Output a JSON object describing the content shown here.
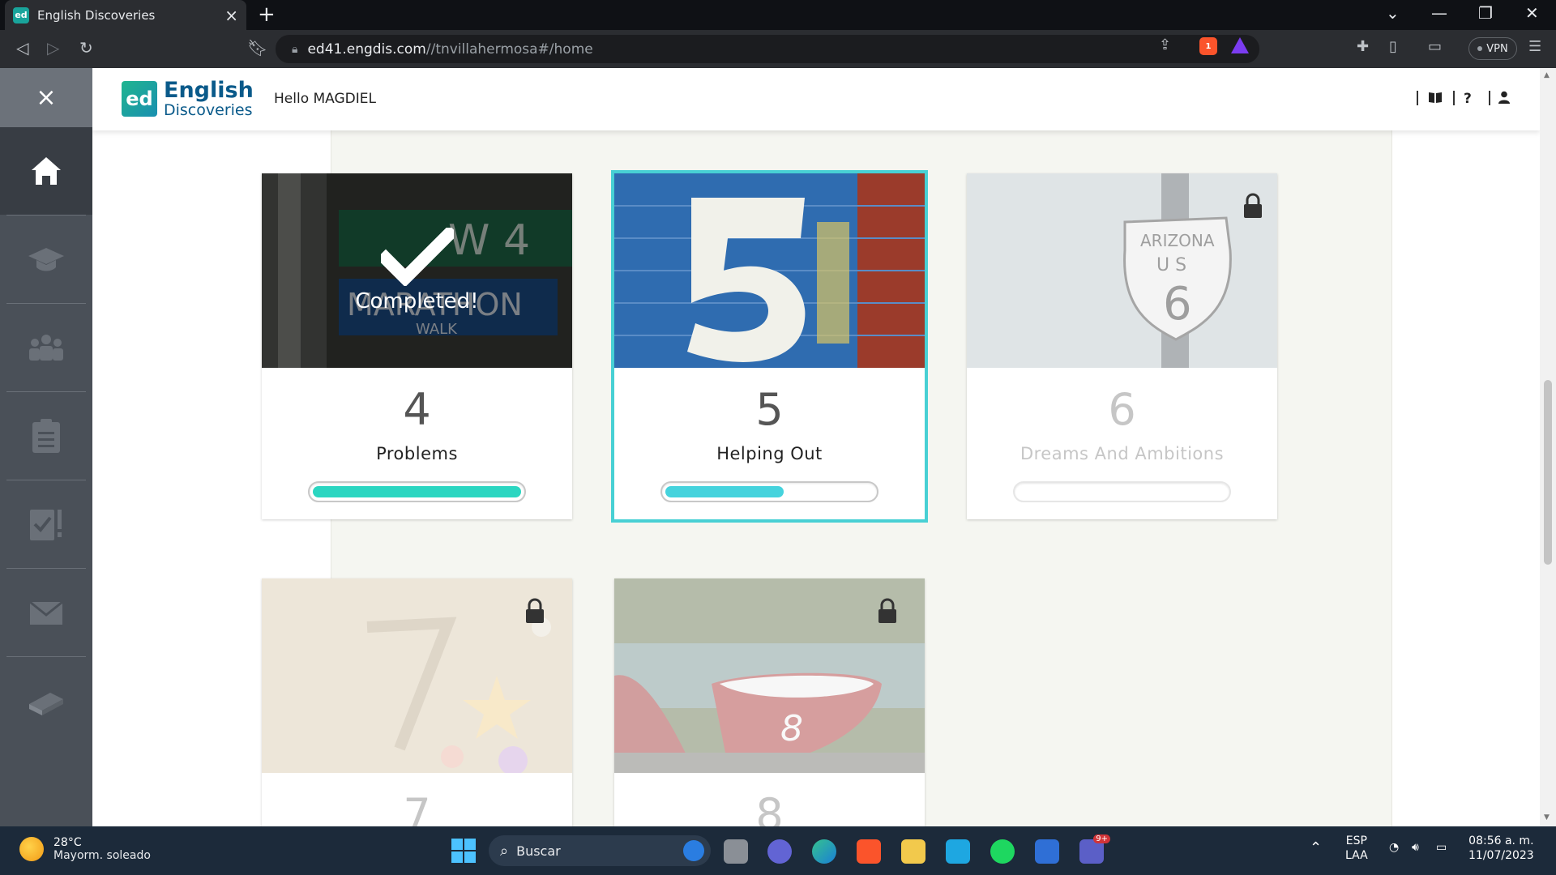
{
  "browser": {
    "tab_title": "English Discoveries",
    "tab_favicon": "ed",
    "url_host": "ed41.engdis.com",
    "url_path": "//tnvillahermosa#/home",
    "vpn_label": "VPN",
    "brave_count": "1"
  },
  "app": {
    "logo_badge": "ed",
    "logo_line1": "English",
    "logo_line2": "Discoveries",
    "greeting": "Hello MAGDIEL",
    "header_icons": [
      "book-icon",
      "help-icon",
      "user-icon"
    ],
    "help_label": "?"
  },
  "sidebar": {
    "close_label": "×",
    "items": [
      {
        "name": "home",
        "icon": "home-icon",
        "active": true
      },
      {
        "name": "courses",
        "icon": "graduation-cap-icon",
        "active": false
      },
      {
        "name": "community",
        "icon": "users-icon",
        "active": false
      },
      {
        "name": "assignments",
        "icon": "clipboard-icon",
        "active": false
      },
      {
        "name": "tests",
        "icon": "test-check-icon",
        "active": false
      },
      {
        "name": "messages",
        "icon": "envelope-icon",
        "active": false
      },
      {
        "name": "library",
        "icon": "book-stack-icon",
        "active": false
      }
    ]
  },
  "units": [
    {
      "number": "4",
      "title": "Problems",
      "progress": 1.0,
      "status": "completed",
      "status_label": "Completed!",
      "image": "street-sign-marathon"
    },
    {
      "number": "5",
      "title": "Helping Out",
      "progress": 0.57,
      "status": "current",
      "image": "painted-number-5-wall"
    },
    {
      "number": "6",
      "title": "Dreams And Ambitions",
      "progress": 0.0,
      "status": "locked",
      "image": "arizona-us-6-sign"
    },
    {
      "number": "7",
      "title": "",
      "progress": 0.0,
      "status": "locked",
      "image": "number-7-sand-starfish"
    },
    {
      "number": "8",
      "title": "",
      "progress": 0.0,
      "status": "locked",
      "image": "rowboats-number-8"
    }
  ],
  "taskbar": {
    "temperature": "28°C",
    "weather_desc": "Mayorm. soleado",
    "search_placeholder": "Buscar",
    "lang1": "ESP",
    "lang2": "LAA",
    "time": "08:56 a. m.",
    "date": "11/07/2023",
    "teams_badge": "9+"
  },
  "colors": {
    "accent": "#48d0d4",
    "progress_fill": "#2bd6c1",
    "sidebar_bg": "#4a5058",
    "brand_blue": "#0a5a8a"
  }
}
